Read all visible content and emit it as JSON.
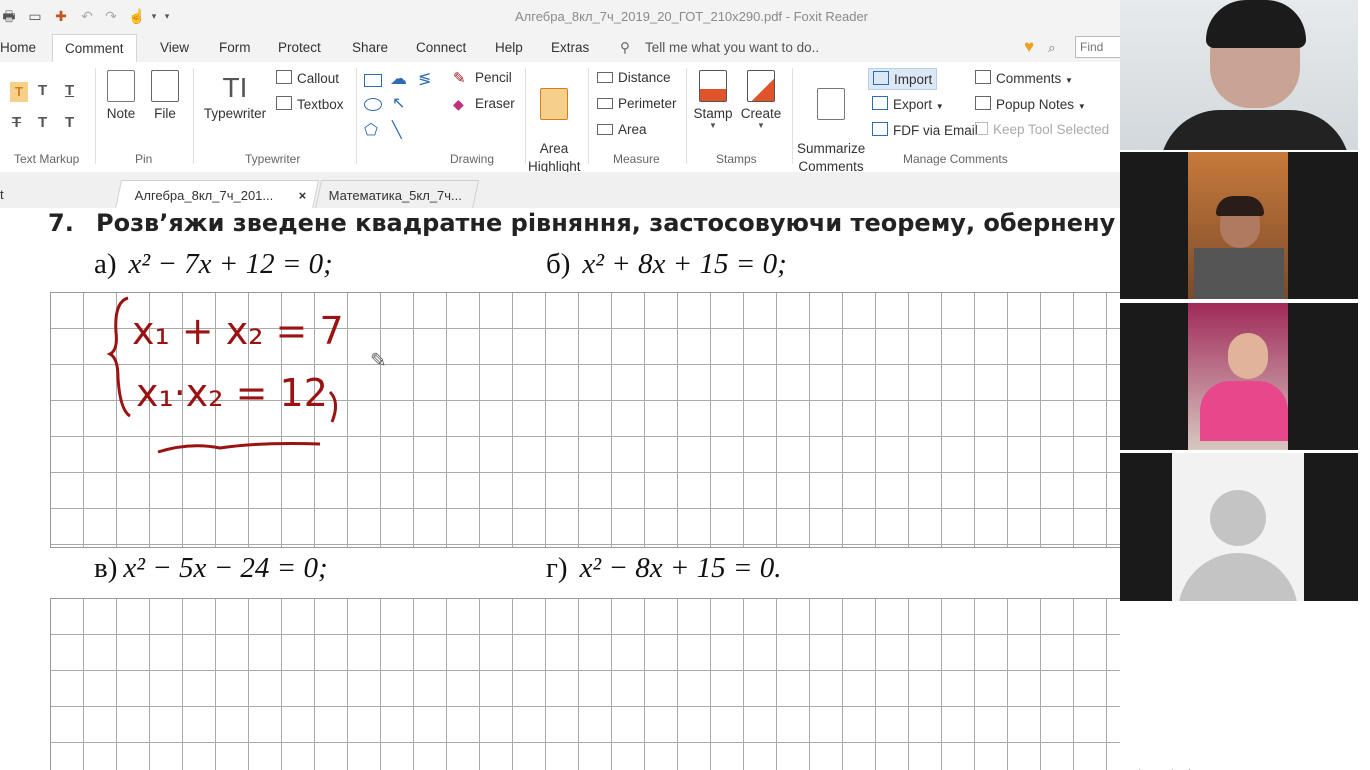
{
  "window": {
    "title": "Алгебра_8кл_7ч_2019_20_ГОТ_210х290.pdf - Foxit Reader"
  },
  "menu": [
    "Home",
    "Comment",
    "View",
    "Form",
    "Protect",
    "Share",
    "Connect",
    "Help",
    "Extras"
  ],
  "tell_me": "Tell me what you want to do..",
  "find": {
    "placeholder": "Find"
  },
  "ribbon": {
    "pin": {
      "note": "Note",
      "file": "File"
    },
    "typewriter": {
      "typewriter": "Typewriter",
      "callout": "Callout",
      "textbox": "Textbox"
    },
    "drawing": {
      "pencil": "Pencil",
      "eraser": "Eraser"
    },
    "area_highlight": "Area\nHighlight",
    "measure": {
      "distance": "Distance",
      "perimeter": "Perimeter",
      "area": "Area"
    },
    "stamps": {
      "stamp": "Stamp",
      "create": "Create"
    },
    "manage": {
      "summarize": "Summarize\nComments",
      "import": "Import",
      "export": "Export",
      "fdf_email": "FDF via Email",
      "comments": "Comments",
      "popup_notes": "Popup Notes",
      "keep_tool": "Keep Tool Selected"
    },
    "groups": {
      "text_markup": "Text Markup",
      "pin": "Pin",
      "typewriter": "Typewriter",
      "drawing": "Drawing",
      "measure": "Measure",
      "stamps": "Stamps",
      "manage_comments": "Manage Comments"
    }
  },
  "tabs": {
    "partial": "t",
    "active": "Алгебра_8кл_7ч_201...",
    "close": "×",
    "second": "Математика_5кл_7ч..."
  },
  "document": {
    "task_number": "7.",
    "task_text": "Розв’яжи зведене квадратне рівняння, застосовуючи теорему, обернену до теореми",
    "eq_a": {
      "label": "а)",
      "rest": "x² − 7x + 12 = 0;"
    },
    "eq_b": {
      "label": "б)",
      "rest": "x² + 8x + 15 = 0;"
    },
    "eq_c": {
      "label": "в)",
      "rest": "x² − 5x − 24 = 0;"
    },
    "eq_d": {
      "label": "г)",
      "rest": "x² − 8x + 15 = 0."
    },
    "handwriting": {
      "line1": "x₁ + x₂ = 7",
      "line2": "x₁·x₂ = 12"
    }
  },
  "colors": {
    "ink": "#9b1212",
    "accent": "#2e6bb5",
    "toolbar_bg": "#f3f3f3"
  }
}
